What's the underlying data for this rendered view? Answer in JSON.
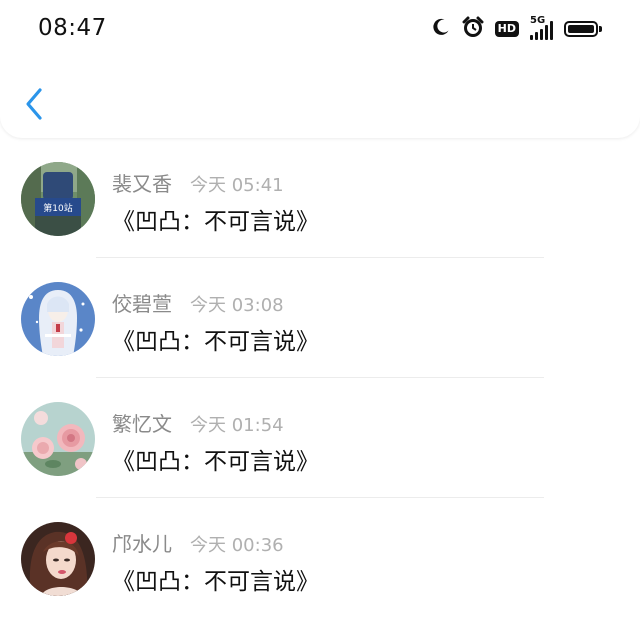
{
  "status_bar": {
    "time": "08:47",
    "icons": [
      "moon-icon",
      "alarm-icon",
      "hd-icon",
      "5g-signal-icon",
      "battery-icon"
    ],
    "hd_label": "HD",
    "network_label": "5G"
  },
  "nav": {
    "back_icon": "chevron-left-icon",
    "accent_color": "#2b95ea"
  },
  "messages": [
    {
      "name": "裴又香",
      "time": "今天 05:41",
      "text": "《凹凸：不可言说》",
      "avatar": "station-sign-photo",
      "avatar_text": "第10站"
    },
    {
      "name": "佼碧萱",
      "time": "今天 03:08",
      "text": "《凹凸：不可言说》",
      "avatar": "anime-girl-illustration"
    },
    {
      "name": "繁忆文",
      "time": "今天 01:54",
      "text": "《凹凸：不可言说》",
      "avatar": "pink-roses-photo"
    },
    {
      "name": "邝水儿",
      "time": "今天 00:36",
      "text": "《凹凸：不可言说》",
      "avatar": "woman-portrait-photo"
    }
  ]
}
